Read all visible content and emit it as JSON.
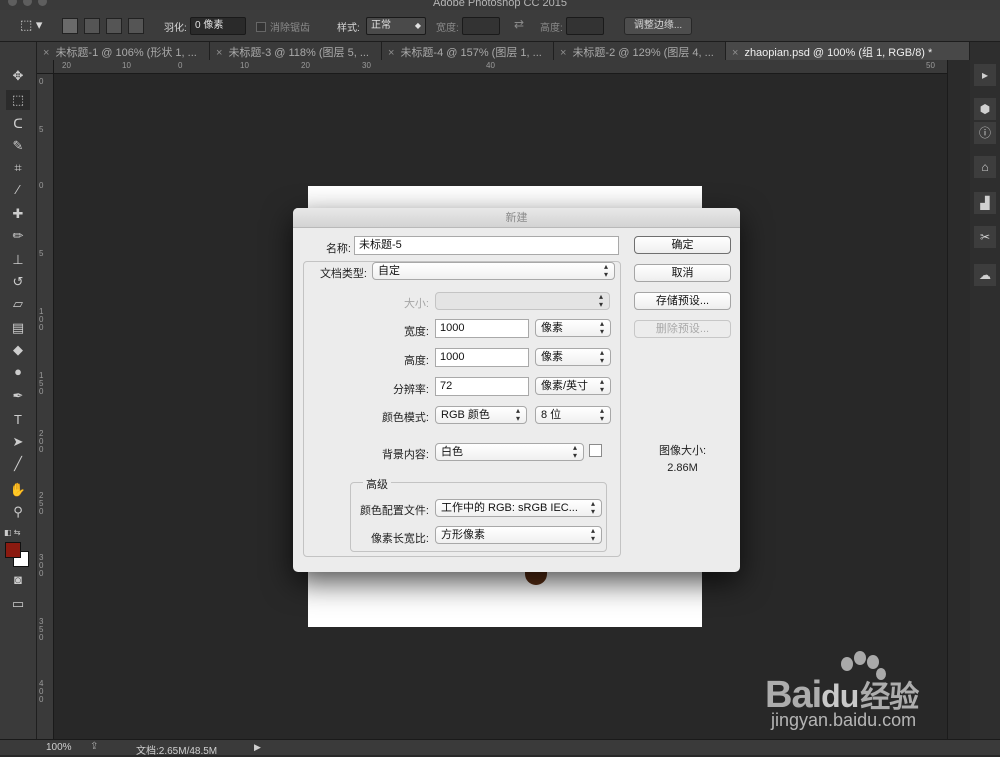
{
  "app_title": "Adobe Photoshop CC 2015",
  "options_bar": {
    "feather_label": "羽化:",
    "feather_value": "0 像素",
    "antialias_label": "消除锯齿",
    "style_label": "样式:",
    "style_value": "正常",
    "width_label": "宽度:",
    "height_label": "高度:",
    "refine_edge_label": "调整边缘..."
  },
  "tabs": [
    {
      "label": "未标题-1 @ 106% (形状 1, ..."
    },
    {
      "label": "未标题-3 @ 118% (图层 5, ..."
    },
    {
      "label": "未标题-4 @ 157% (图层 1, ..."
    },
    {
      "label": "未标题-2 @ 129% (图层 4, ..."
    },
    {
      "label": "zhaopian.psd @ 100% (组 1, RGB/8) *",
      "active": true
    }
  ],
  "ruler_h": [
    "20",
    "10",
    "0",
    "10",
    "20",
    "30",
    "40",
    "50"
  ],
  "ruler_v": [
    "0",
    "5",
    "0",
    "5",
    "1 0 0",
    "1 5 0",
    "2 0 0",
    "2 5 0",
    "3 0 0",
    "3 5 0",
    "4 0 0"
  ],
  "dialog": {
    "title": "新建",
    "name_label": "名称:",
    "name_value": "未标题-5",
    "doc_type_label": "文档类型:",
    "doc_type_value": "自定",
    "size_label": "大小:",
    "size_value": "",
    "width_label": "宽度:",
    "width_value": "1000",
    "width_unit": "像素",
    "height_label": "高度:",
    "height_value": "1000",
    "height_unit": "像素",
    "resolution_label": "分辨率:",
    "resolution_value": "72",
    "resolution_unit": "像素/英寸",
    "color_mode_label": "颜色模式:",
    "color_mode_value": "RGB 颜色",
    "bit_depth_value": "8 位",
    "background_label": "背景内容:",
    "background_value": "白色",
    "advanced_label": "高级",
    "color_profile_label": "颜色配置文件:",
    "color_profile_value": "工作中的 RGB: sRGB IEC...",
    "pixel_aspect_label": "像素长宽比:",
    "pixel_aspect_value": "方形像素",
    "ok_button": "确定",
    "cancel_button": "取消",
    "save_preset_button": "存储预设...",
    "delete_preset_button": "删除预设...",
    "image_size_label": "图像大小:",
    "image_size_value": "2.86M"
  },
  "status": {
    "zoom": "100%",
    "doc_info": "文档:2.65M/48.5M"
  },
  "watermark": {
    "brand": "Bai",
    "brand2": "du",
    "jingyan": "经验",
    "url": "jingyan.baidu.com"
  },
  "colors": {
    "foreground": "#8b1a10",
    "background": "#ffffff"
  }
}
